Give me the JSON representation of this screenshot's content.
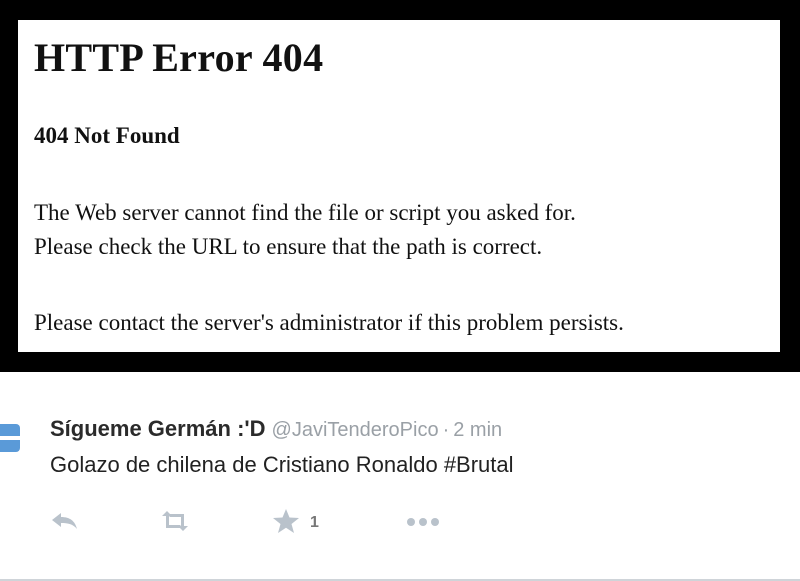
{
  "error_page": {
    "title": "HTTP Error 404",
    "subtitle": "404 Not Found",
    "line1": "The Web server cannot find the file or script you asked for.",
    "line2": "Please check the URL to ensure that the path is correct.",
    "line3": "Please contact the server's administrator if this problem persists."
  },
  "tweet": {
    "display_name": "Sígueme Germán :'D",
    "handle": "@JaviTenderoPico",
    "separator": "·",
    "time": "2 min",
    "text_prefix": "Golazo de chilena de Cristiano Ronaldo ",
    "hashtag": "#Brutal",
    "actions": {
      "reply_icon": "reply-icon",
      "retweet_icon": "retweet-icon",
      "favorite_icon": "star-icon",
      "favorite_count": "1",
      "more_icon": "more-dots-icon"
    }
  },
  "colors": {
    "frame": "#000000",
    "muted": "#9aa0a6",
    "icon": "#b9c2cb",
    "avatar": "#5a9ad8"
  }
}
